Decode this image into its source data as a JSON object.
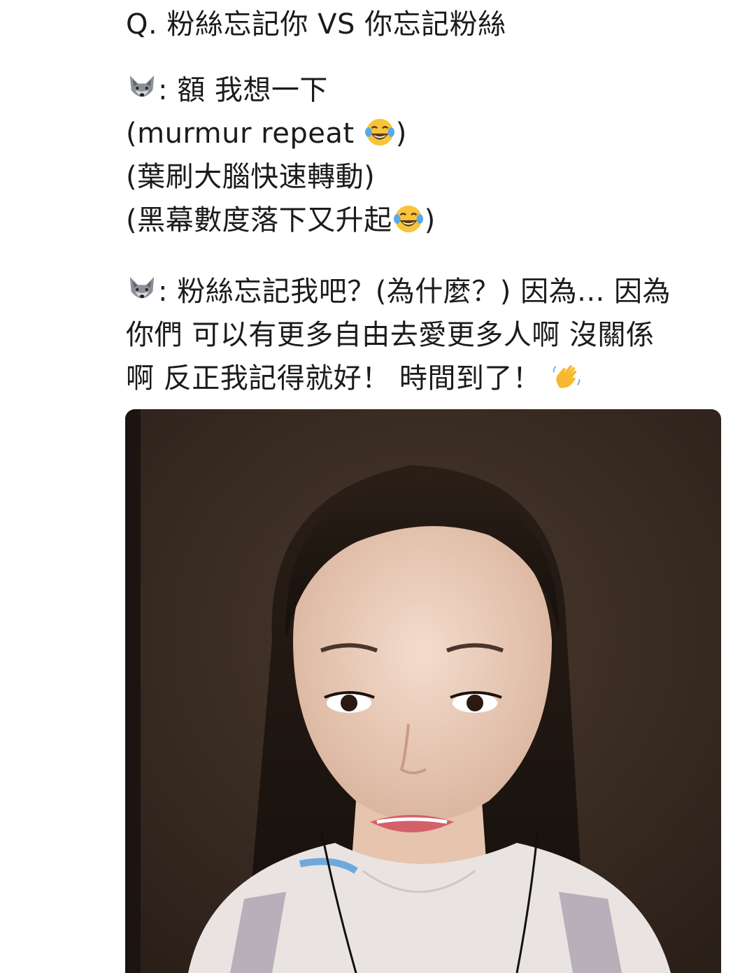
{
  "post": {
    "question": "Q. 粉絲忘記你 VS 你忘記粉絲",
    "answer1": {
      "speaker_icon": "wolf-emoji",
      "line1_text": ": 額 我想一下",
      "line2_prefix": "(murmur repeat ",
      "line2_emoji": "tears-of-joy-emoji",
      "line2_suffix": ")",
      "line3_text": "(葉刷大腦快速轉動)",
      "line4_prefix": "(黑幕數度落下又升起",
      "line4_emoji": "tears-of-joy-emoji",
      "line4_suffix": ")"
    },
    "answer2": {
      "speaker_icon": "wolf-emoji",
      "line1_text": ": 粉絲忘記我吧？(為什麼？) 因為... 因為",
      "line2_text": "你們 可以有更多自由去愛更多人啊 沒關係",
      "line3_text": "啊 反正我記得就好！ 時間到了！ ",
      "line3_emoji": "waving-hand-emoji"
    }
  },
  "media": {
    "type": "video-still",
    "subject": "woman-on-livestream"
  },
  "colors": {
    "text": "#1b1b1b",
    "background": "#ffffff",
    "media_background": "#3a2c22"
  }
}
